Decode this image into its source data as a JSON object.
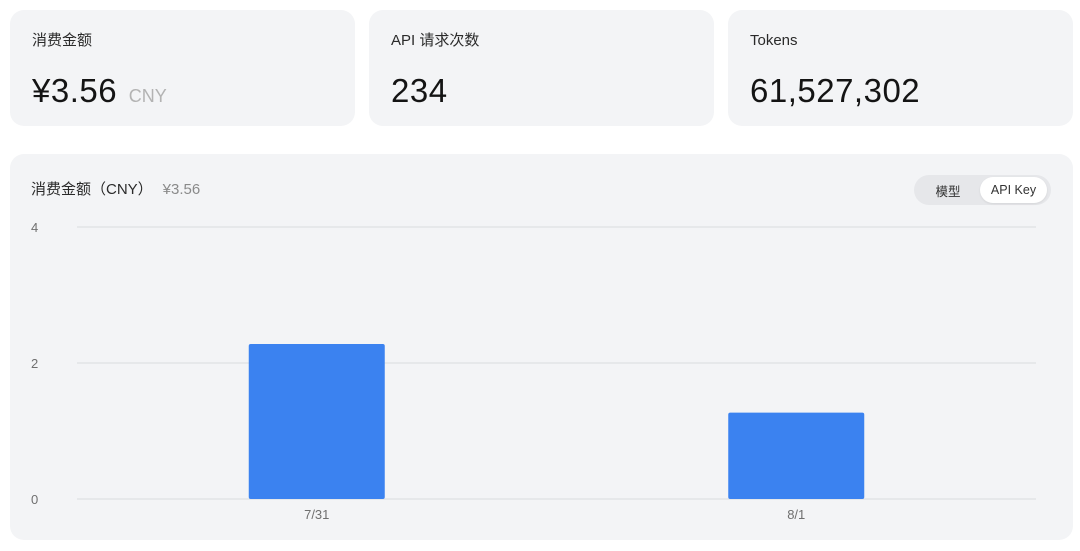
{
  "stats": [
    {
      "label": "消费金额",
      "value": "¥3.56",
      "unit": "CNY"
    },
    {
      "label": "API 请求次数",
      "value": "234"
    },
    {
      "label": "Tokens",
      "value": "61,527,302"
    }
  ],
  "chart_card": {
    "title": "消费金额（CNY）",
    "total": "¥3.56",
    "toggle": {
      "options": [
        "模型",
        "API Key"
      ],
      "selected": "API Key"
    }
  },
  "colors": {
    "bar": "#3b82f0",
    "card": "#f3f4f6",
    "grid": "#d9dcdf"
  },
  "chart_data": {
    "type": "bar",
    "categories": [
      "7/31",
      "8/1"
    ],
    "values": [
      2.28,
      1.27
    ],
    "y_ticks": [
      "0",
      "2",
      "4"
    ],
    "ylim": [
      0,
      4
    ],
    "title": "消费金额（CNY）",
    "xlabel": "",
    "ylabel": "",
    "grid": true
  }
}
